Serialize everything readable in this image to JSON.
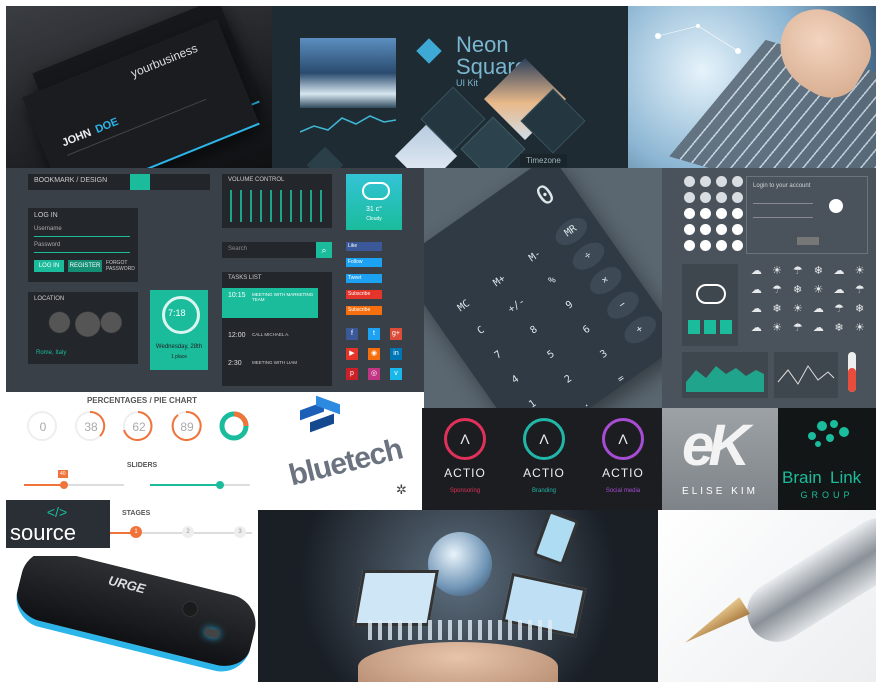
{
  "business_card": {
    "brand": "yourbusiness",
    "name_first": "JOHN",
    "name_last": "DOE"
  },
  "neon_square": {
    "title_line1": "Neon",
    "title_line2": "Square",
    "subtitle": "UI Kit",
    "thumb_label": "Timezone"
  },
  "dashboard": {
    "top_bar_label": "BOOKMARK / DESIGN",
    "login": {
      "title": "LOG IN",
      "username": "Username",
      "password": "Password",
      "login_btn": "LOG IN",
      "register_btn": "REGISTER",
      "forgot": "FORGOT PASSWORD"
    },
    "volume_title": "VOLUME CONTROL",
    "search_placeholder": "Search",
    "weather": {
      "temp": "31 c°",
      "cond": "Cloudy"
    },
    "location": {
      "title": "LOCATION",
      "place": "Rome, Italy"
    },
    "clock": {
      "time": "7:18",
      "date": "Wednesday, 28th",
      "meta": "1 place"
    },
    "tasks": {
      "title": "TASKS LIST",
      "items": [
        {
          "time": "10:15",
          "text": "MEETING WITH MARKETING TEAM"
        },
        {
          "time": "12:00",
          "text": "CALL MICHAEL A."
        },
        {
          "time": "2:30",
          "text": "MEETING WITH LIAM"
        }
      ]
    },
    "social": [
      {
        "label": "Like",
        "color": "#3b5998"
      },
      {
        "label": "Follow",
        "color": "#1da1f2"
      },
      {
        "label": "Tweet",
        "color": "#1da1f2"
      },
      {
        "label": "Subscribe",
        "color": "#e5352b"
      },
      {
        "label": "Subscribe",
        "color": "#f56f0f"
      }
    ],
    "social_icons": [
      {
        "glyph": "f",
        "color": "#3b5998"
      },
      {
        "glyph": "t",
        "color": "#1da1f2"
      },
      {
        "glyph": "g+",
        "color": "#dd4b39"
      },
      {
        "glyph": "▶",
        "color": "#e5352b"
      },
      {
        "glyph": "◉",
        "color": "#f56f0f"
      },
      {
        "glyph": "in",
        "color": "#0077b5"
      },
      {
        "glyph": "p",
        "color": "#cb2027"
      },
      {
        "glyph": "◎",
        "color": "#c13584"
      },
      {
        "glyph": "v",
        "color": "#1ab7ea"
      }
    ]
  },
  "calculator": {
    "display": "0",
    "keys": [
      "MC",
      "M+",
      "M-",
      "MR",
      "C",
      "+/-",
      "%",
      "÷",
      "7",
      "8",
      "9",
      "×",
      "4",
      "5",
      "6",
      "−",
      "1",
      "2",
      "3",
      "+",
      "0",
      ".",
      "="
    ]
  },
  "weather_kit": {
    "login_title": "Login to your account"
  },
  "percentages": {
    "title": "PERCENTAGES / PIE CHART",
    "values": [
      "0",
      "38",
      "62",
      "89"
    ],
    "sliders_title": "SLIDERS",
    "slider_badge": "40",
    "stages_title": "STAGES",
    "stages": [
      "1",
      "2",
      "3",
      "4"
    ]
  },
  "bluetech": {
    "brand": "bluetech"
  },
  "actio": [
    {
      "name": "ACTIO",
      "tag": "Sponsoring",
      "color": "#e1315b"
    },
    {
      "name": "ACTIO",
      "tag": "Branding",
      "color": "#21b6a8"
    },
    {
      "name": "ACTIO",
      "tag": "Social media",
      "color": "#a64dd3"
    }
  ],
  "elise": {
    "name": "ELISE KIM"
  },
  "brainlink": {
    "name_a": "Brain",
    "name_b": "Link",
    "sub": "GROUP"
  },
  "source": {
    "brand": "source"
  },
  "powerbank": {
    "brand": "URGE"
  },
  "colors": {
    "accent_blue": "#2bb5e8",
    "teal": "#1abc9c",
    "orange": "#f0743a",
    "dark": "#1d1f24"
  }
}
